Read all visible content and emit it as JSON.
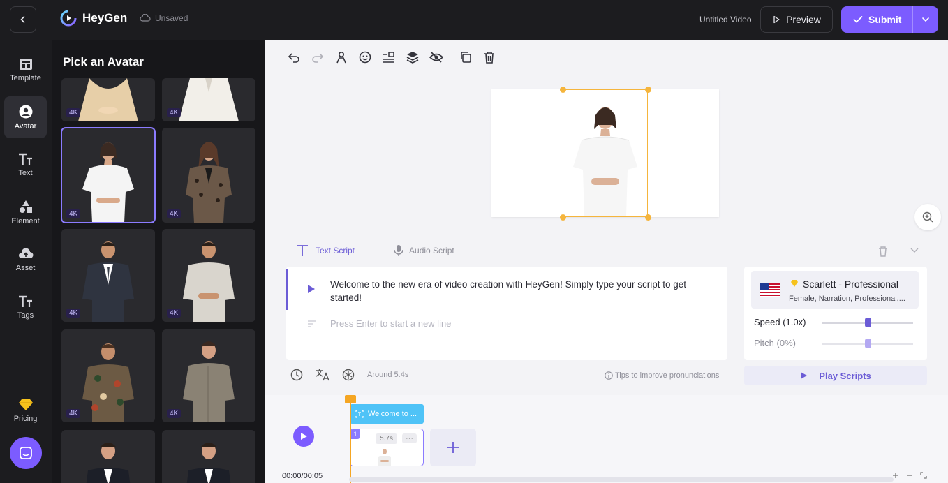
{
  "header": {
    "brand": "HeyGen",
    "save_status": "Unsaved",
    "video_title": "Untitled Video",
    "preview_label": "Preview",
    "submit_label": "Submit"
  },
  "rail": {
    "items": [
      {
        "label": "Template",
        "icon": "template-icon"
      },
      {
        "label": "Avatar",
        "icon": "avatar-icon"
      },
      {
        "label": "Text",
        "icon": "text-icon"
      },
      {
        "label": "Element",
        "icon": "element-icon"
      },
      {
        "label": "Asset",
        "icon": "asset-icon"
      },
      {
        "label": "Tags",
        "icon": "tags-icon"
      }
    ],
    "pricing_label": "Pricing",
    "active": "Avatar"
  },
  "avatar_panel": {
    "title": "Pick an Avatar",
    "badge": "4K"
  },
  "script": {
    "text_tab": "Text Script",
    "audio_tab": "Audio Script",
    "text": "Welcome to the new era of video creation with HeyGen! Simply type your script to get started!",
    "new_line_placeholder": "Press Enter to start a new line",
    "duration_estimate": "Around 5.4s",
    "tips": "Tips to improve pronunciations"
  },
  "voice": {
    "name": "Scarlett - Professional",
    "meta": "Female, Narration, Professional,...",
    "speed_label": "Speed (1.0x)",
    "pitch_label": "Pitch (0%)",
    "speed_value": 0.5,
    "pitch_value": 0.5,
    "play_label": "Play Scripts"
  },
  "timeline": {
    "clip_label": "Welcome to ...",
    "clip_number": "1",
    "clip_duration": "5.7s",
    "clip_more": "···",
    "time": "00:00/00:05"
  },
  "colors": {
    "accent": "#7c5cff",
    "selection": "#f5b53d",
    "text_clip": "#4fc3f7"
  }
}
